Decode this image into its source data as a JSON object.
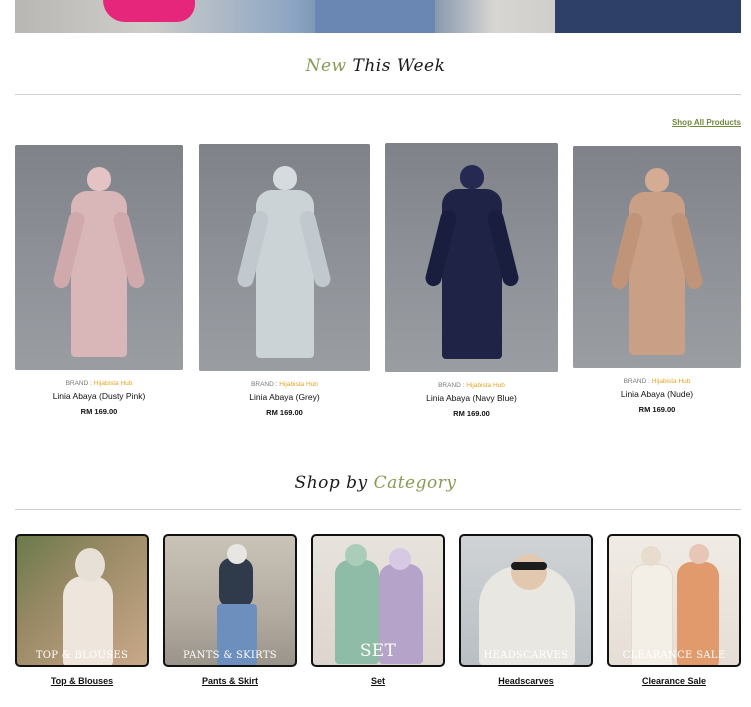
{
  "new_this_week": {
    "title_accent": "New",
    "title_main": "This Week",
    "shop_all": "Shop All Products"
  },
  "products": [
    {
      "brand_prefix": "BRAND :",
      "brand": "Hijabista Hub",
      "name": "Linia Abaya (Dusty Pink)",
      "price": "RM 169.00",
      "color": "#d7b3b5"
    },
    {
      "brand_prefix": "BRAND :",
      "brand": "Hijabista Hub",
      "name": "Linia Abaya (Grey)",
      "price": "RM 169.00",
      "color": "#c9d0d4"
    },
    {
      "brand_prefix": "BRAND :",
      "brand": "Hijabista Hub",
      "name": "Linia Abaya (Navy Blue)",
      "price": "RM 169.00",
      "color": "#1e2244"
    },
    {
      "brand_prefix": "BRAND :",
      "brand": "Hijabista Hub",
      "name": "Linia Abaya (Nude)",
      "price": "RM 169.00",
      "color": "#c79c82"
    }
  ],
  "shop_by_category": {
    "title_main": "Shop by",
    "title_accent": "Category"
  },
  "categories": [
    {
      "overlay": "TOP & BLOUSES",
      "link": "Top & Blouses"
    },
    {
      "overlay": "PANTS & SKIRTS",
      "link": "Pants & Skirt"
    },
    {
      "overlay": "SET",
      "link": "Set"
    },
    {
      "overlay": "HEADSCARVES",
      "link": "Headscarves"
    },
    {
      "overlay": "CLEARANCE SALE",
      "link": "Clearance Sale"
    }
  ],
  "colors": {
    "accent_green": "#6f8a3a",
    "brand_orange": "#e3a627"
  }
}
